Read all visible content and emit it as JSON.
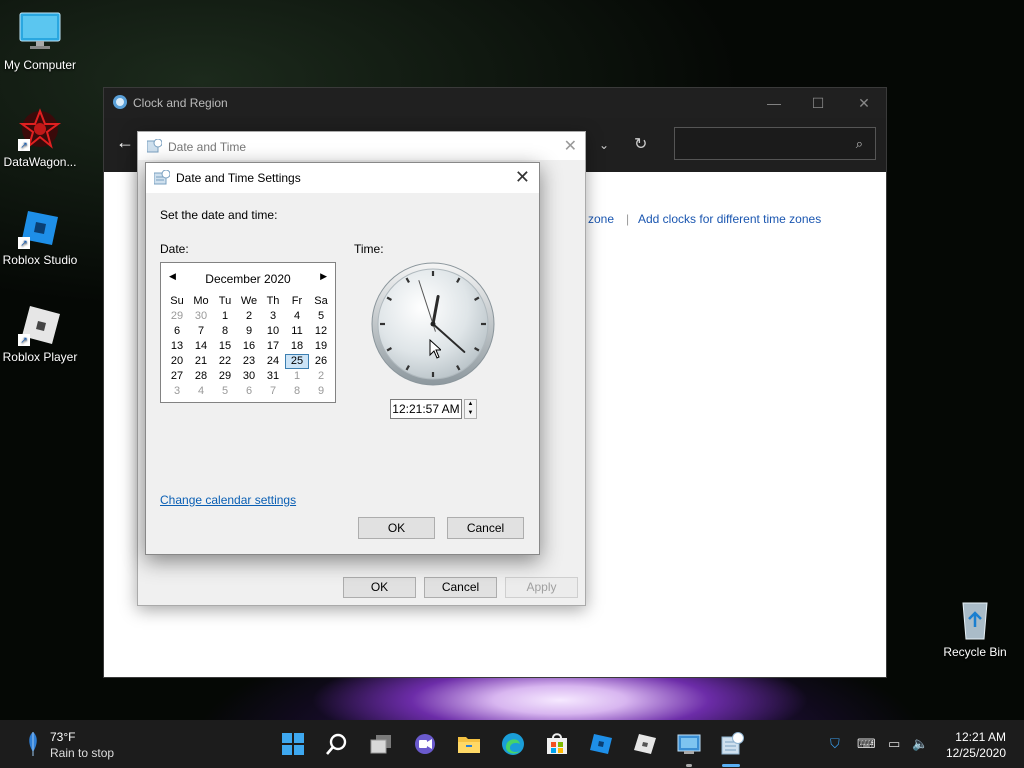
{
  "desktop": {
    "icons": [
      {
        "label": "My Computer",
        "icon": "monitor-icon"
      },
      {
        "label": "DataWagon...",
        "icon": "datawagon-icon"
      },
      {
        "label": "Roblox Studio",
        "icon": "roblox-studio-icon"
      },
      {
        "label": "Roblox Player",
        "icon": "roblox-player-icon"
      },
      {
        "label": "Recycle Bin",
        "icon": "recycle-bin-icon"
      }
    ]
  },
  "clock_region_window": {
    "title": "Clock and Region",
    "links": {
      "time_zone_partial": "e zone",
      "add_clocks": "Add clocks for different time zones",
      "separator": "|"
    }
  },
  "date_time_dialog": {
    "title": "Date and Time",
    "buttons": {
      "ok": "OK",
      "cancel": "Cancel",
      "apply": "Apply"
    }
  },
  "date_time_settings": {
    "title": "Date and Time Settings",
    "instruction": "Set the date and time:",
    "date_label": "Date:",
    "time_label": "Time:",
    "calendar": {
      "month_year": "December 2020",
      "weekdays": [
        "Su",
        "Mo",
        "Tu",
        "We",
        "Th",
        "Fr",
        "Sa"
      ],
      "weeks": [
        [
          "29",
          "30",
          "1",
          "2",
          "3",
          "4",
          "5"
        ],
        [
          "6",
          "7",
          "8",
          "9",
          "10",
          "11",
          "12"
        ],
        [
          "13",
          "14",
          "15",
          "16",
          "17",
          "18",
          "19"
        ],
        [
          "20",
          "21",
          "22",
          "23",
          "24",
          "25",
          "26"
        ],
        [
          "27",
          "28",
          "29",
          "30",
          "31",
          "1",
          "2"
        ],
        [
          "3",
          "4",
          "5",
          "6",
          "7",
          "8",
          "9"
        ]
      ],
      "selected_day": "25"
    },
    "time_value": "12:21:57 AM",
    "clock": {
      "hour": 0,
      "minute": 21,
      "second": 57
    },
    "change_calendar_link": "Change calendar settings",
    "buttons": {
      "ok": "OK",
      "cancel": "Cancel"
    }
  },
  "taskbar": {
    "weather": {
      "temp": "73°F",
      "desc": "Rain to stop"
    },
    "clock": {
      "time": "12:21 AM",
      "date": "12/25/2020"
    },
    "pinned": [
      "start-icon",
      "search-icon",
      "task-view-icon",
      "chat-icon",
      "file-explorer-icon",
      "edge-icon",
      "store-icon",
      "roblox-studio-icon",
      "roblox-player-icon",
      "control-panel-icon",
      "date-time-icon"
    ]
  }
}
